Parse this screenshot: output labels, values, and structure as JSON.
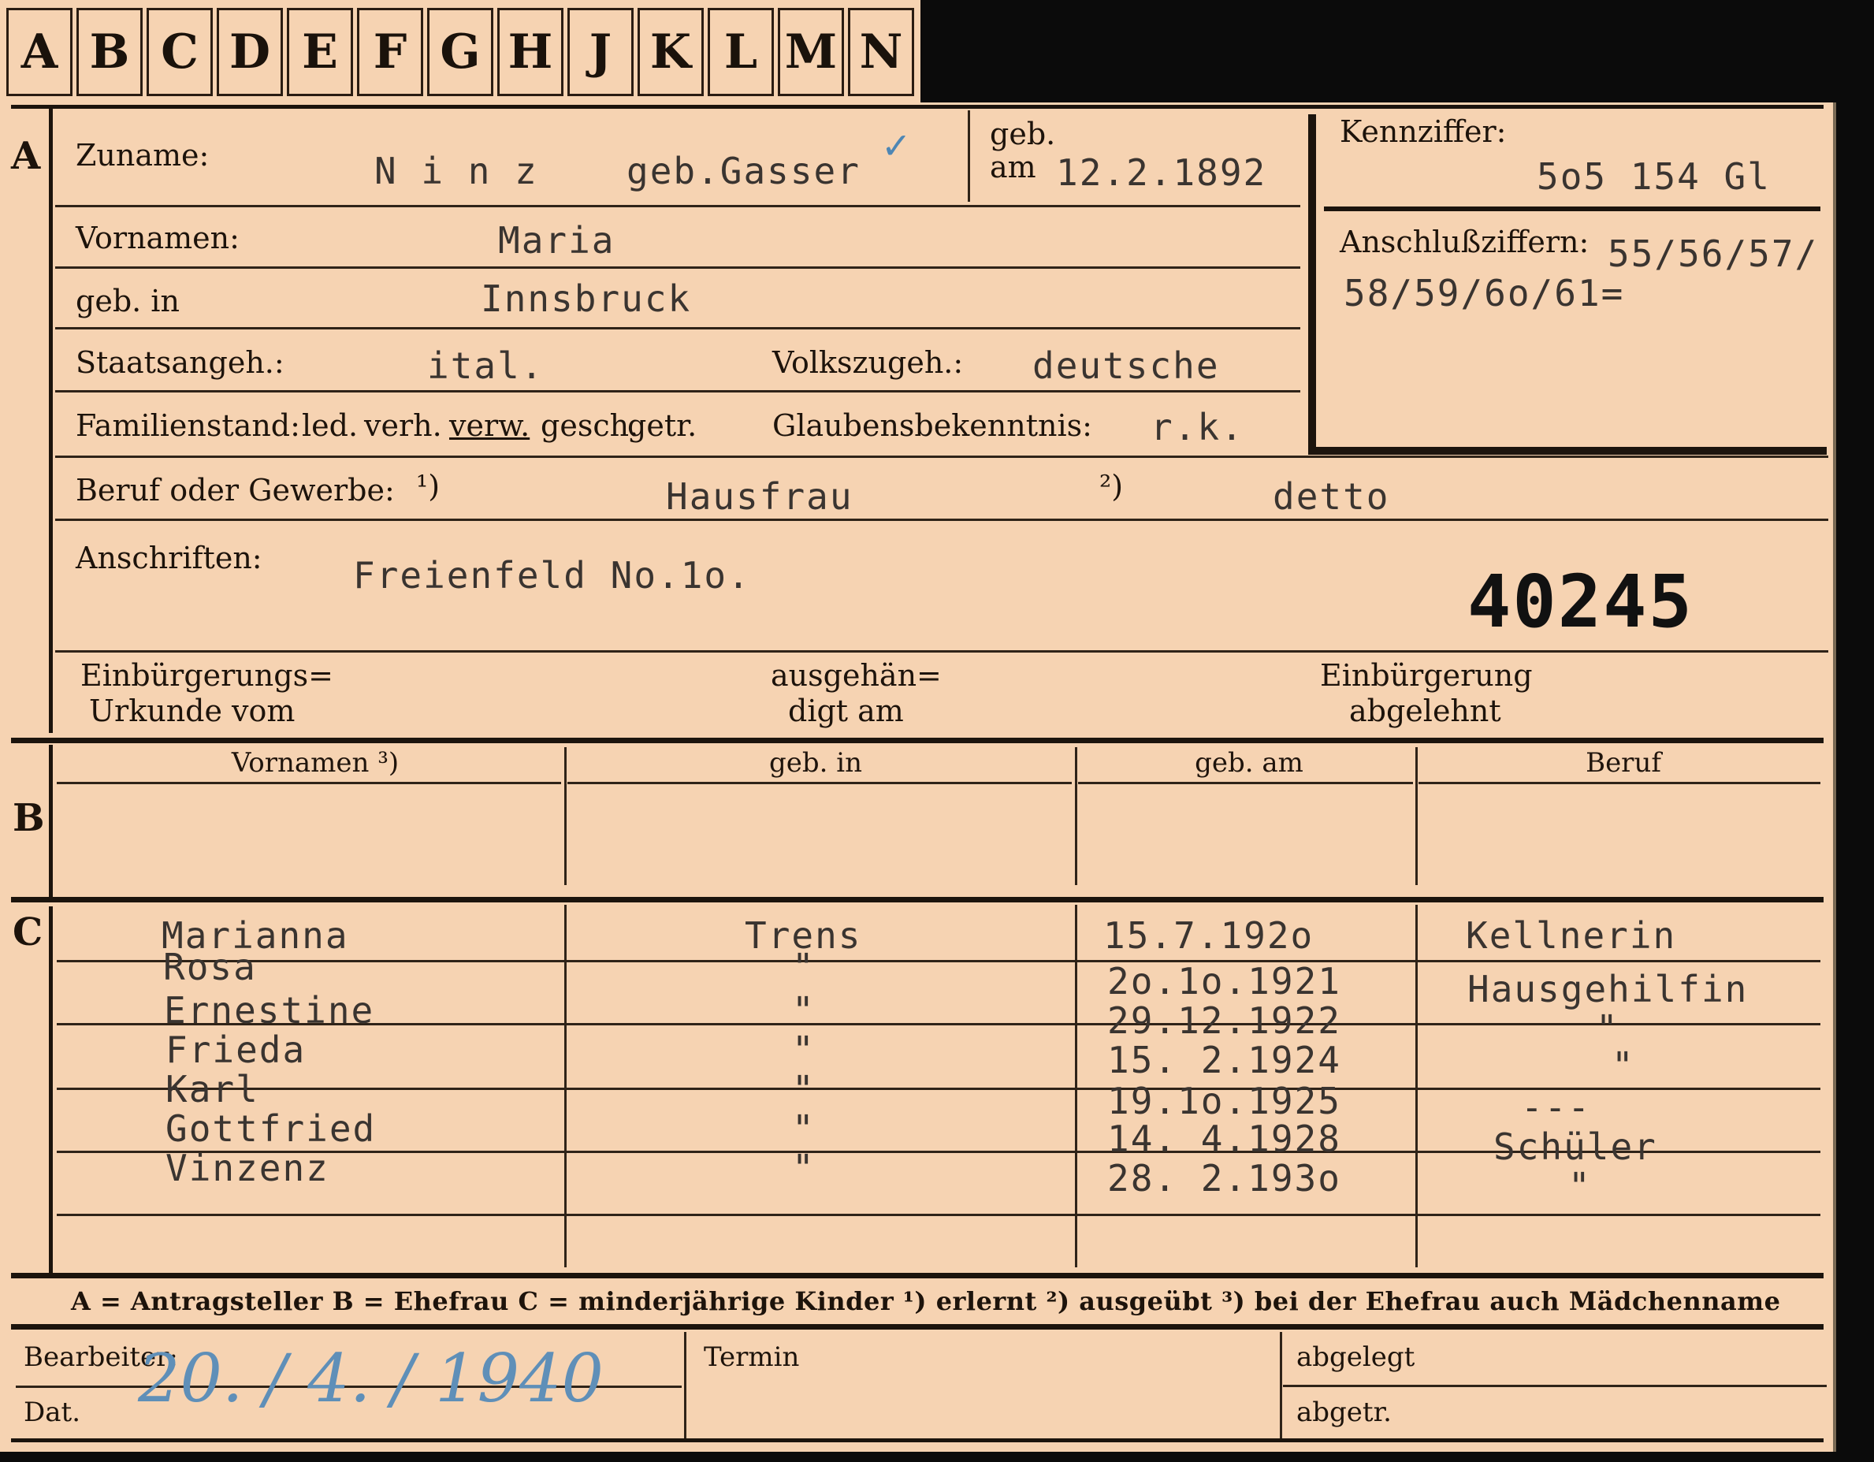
{
  "tabs": [
    "A",
    "B",
    "C",
    "D",
    "E",
    "F",
    "G",
    "H",
    "J",
    "K",
    "L",
    "M",
    "N"
  ],
  "section_letters": {
    "A": "A",
    "B": "B",
    "C": "C"
  },
  "labels": {
    "zuname": "Zuname:",
    "geb": "geb.",
    "am": "am",
    "kennziffer": "Kennziffer:",
    "vornamen": "Vornamen:",
    "anschlussziffern": "Anschlußziffern:",
    "geb_in": "geb. in",
    "staatsangeh": "Staatsangeh.:",
    "volkszugeh": "Volkszugeh.:",
    "familienstand": "Familienstand:",
    "fam_opts": [
      "led.",
      "verh.",
      "verw.",
      "gesch.",
      "getr."
    ],
    "glaubensbekenntnis": "Glaubensbekenntnis:",
    "beruf": "Beruf oder Gewerbe:",
    "note1": "¹)",
    "note2": "²)",
    "anschriften": "Anschriften:",
    "einb_urkunde_1": "Einbürgerungs=",
    "einb_urkunde_2": "Urkunde vom",
    "ausgehaend_1": "ausgehän=",
    "ausgehaend_2": "digt am",
    "einb_abgelehnt_1": "Einbürgerung",
    "einb_abgelehnt_2": "abgelehnt",
    "col_vornamen": "Vornamen ³)",
    "col_geb_in": "geb. in",
    "col_geb_am": "geb. am",
    "col_beruf": "Beruf",
    "legend": "A = Antragsteller   B = Ehefrau   C = minderjährige Kinder   ¹) erlernt   ²) ausgeübt   ³) bei der Ehefrau auch Mädchenname",
    "bearbeiter": "Bearbeiter:",
    "dat": "Dat.",
    "termin": "Termin",
    "abgelegt": "abgelegt",
    "abgetr": "abgetr."
  },
  "values": {
    "zuname": "N i n z",
    "geb_name": "geb.Gasser",
    "check": "✓",
    "geb_date": "12.2.1892",
    "kennziffer": "5o5 154   Gl",
    "vornamen": "Maria",
    "anschluss_1": "55/56/57/",
    "anschluss_2": "58/59/6o/61=",
    "geb_in": "Innsbruck",
    "staatsangeh": "ital.",
    "volkszugeh": "deutsche",
    "glaube": "r.k.",
    "beruf_1": "Hausfrau",
    "beruf_2": "detto",
    "anschrift": "Freienfeld No.1o.",
    "stamp_number": "40245",
    "hand_date": "20. / 4. / 1940"
  },
  "children": [
    {
      "name": "Marianna",
      "place": "Trens",
      "date": "15.7.192o",
      "job": "Kellnerin"
    },
    {
      "name": "Rosa",
      "place": "\"",
      "date": "2o.1o.1921",
      "job": "Hausgehilfin"
    },
    {
      "name": "Ernestine",
      "place": "\"",
      "date": "29.12.1922",
      "job": "\""
    },
    {
      "name": "Frieda",
      "place": "\"",
      "date": "15. 2.1924",
      "job": "\""
    },
    {
      "name": "Karl",
      "place": "\"",
      "date": "19.1o.1925",
      "job": "---"
    },
    {
      "name": "Gottfried",
      "place": "\"",
      "date": "14. 4.1928",
      "job": "Schüler"
    },
    {
      "name": "Vinzenz",
      "place": "\"",
      "date": "28. 2.193o",
      "job": "\""
    }
  ]
}
